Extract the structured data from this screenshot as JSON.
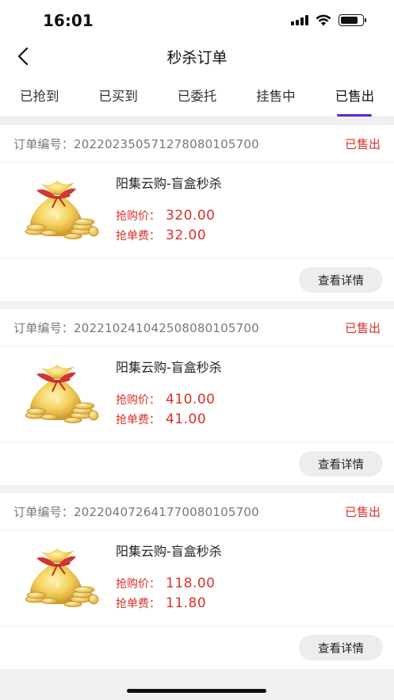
{
  "status_bar": {
    "time": "16:01",
    "battery_level": 0.8
  },
  "nav": {
    "title": "秒杀订单",
    "back_icon": "chevron-left-icon"
  },
  "tabs": [
    {
      "label": "已抢到",
      "active": false
    },
    {
      "label": "已买到",
      "active": false
    },
    {
      "label": "已委托",
      "active": false
    },
    {
      "label": "挂售中",
      "active": false
    },
    {
      "label": "已售出",
      "active": true
    }
  ],
  "colors": {
    "accent": "#5a2bc8",
    "price": "#d8312b",
    "background": "#f1f1f3"
  },
  "orders": [
    {
      "order_label": "订单编号：",
      "order_no": "20220235057127808010570​0",
      "status": "已售出",
      "product_image": "money-bag-icon",
      "product_name": "阳集云购-盲盒秒杀",
      "price_label": "抢购价：",
      "price": "320.00",
      "fee_label": "抢单费：",
      "fee": "32.00",
      "detail_button": "查看详情"
    },
    {
      "order_label": "订单编号：",
      "order_no": "20221024104250808010570​0",
      "status": "已售出",
      "product_image": "money-bag-icon",
      "product_name": "阳集云购-盲盒秒杀",
      "price_label": "抢购价：",
      "price": "410.00",
      "fee_label": "抢单费：",
      "fee": "41.00",
      "detail_button": "查看详情"
    },
    {
      "order_label": "订单编号：",
      "order_no": "20220407264177008010570​0",
      "status": "已售出",
      "product_image": "money-bag-icon",
      "product_name": "阳集云购-盲盒秒杀",
      "price_label": "抢购价：",
      "price": "118.00",
      "fee_label": "抢单费：",
      "fee": "11.80",
      "detail_button": "查看详情"
    }
  ]
}
